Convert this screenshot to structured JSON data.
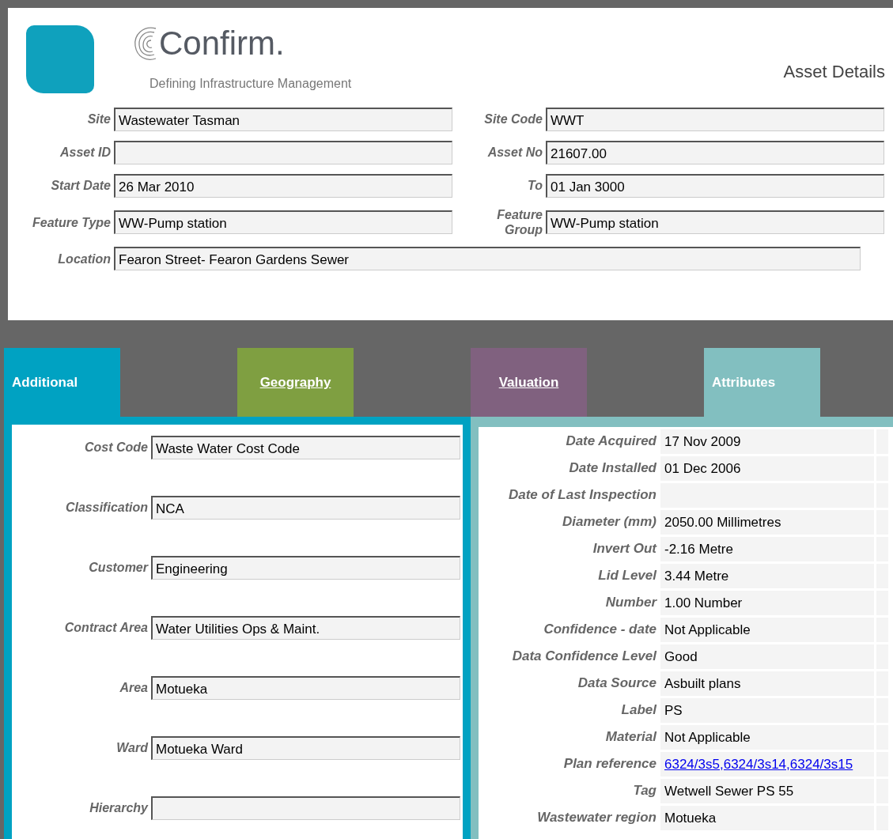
{
  "header": {
    "brand": "Confirm.",
    "tagline": "Defining Infrastructure Management",
    "page_title": "Asset Details"
  },
  "details": [
    {
      "label": "Site",
      "value": "Wastewater Tasman",
      "kind": "pair"
    },
    {
      "label": "Site Code",
      "value": "WWT",
      "kind": "pair"
    },
    {
      "label": "Asset ID",
      "kind": "pair"
    },
    {
      "label": "Asset No",
      "value": "21607.00",
      "kind": "pair"
    },
    {
      "label": "Start Date",
      "value": "26 Mar 2010",
      "kind": "pair"
    },
    {
      "label": "To",
      "value": "01 Jan 3000",
      "kind": "pair"
    },
    {
      "label": "Feature Type",
      "value": "WW-Pump station",
      "kind": "pair"
    },
    {
      "label": "Feature Group",
      "value": "WW-Pump station",
      "kind": "pair"
    },
    {
      "label": "Location",
      "value": "Fearon Street- Fearon Gardens Sewer",
      "kind": "wide"
    }
  ],
  "tabs": [
    {
      "label": "Additional",
      "selected": true,
      "color": "#00a2c2"
    },
    {
      "label": "Geography",
      "selected": false,
      "color": "#7f9f41"
    },
    {
      "label": "Valuation",
      "selected": false,
      "color": "#80617f"
    },
    {
      "label": "Attributes",
      "selected": true,
      "color": "#82bfc0"
    }
  ],
  "additional": [
    {
      "label": "Cost Code",
      "value": "Waste Water Cost Code"
    },
    {
      "label": "Classification",
      "value": "NCA"
    },
    {
      "label": "Customer",
      "value": "Engineering"
    },
    {
      "label": "Contract Area",
      "value": "Water Utilities Ops & Maint."
    },
    {
      "label": "Area",
      "value": "Motueka"
    },
    {
      "label": "Ward",
      "value": "Motueka Ward"
    },
    {
      "label": "Hierarchy"
    }
  ],
  "attributes": [
    {
      "label": "Date Acquired",
      "value": "17 Nov 2009",
      "kind": "text"
    },
    {
      "label": "Date Installed",
      "value": "01 Dec 2006",
      "kind": "text"
    },
    {
      "label": "Date of Last Inspection",
      "kind": "text"
    },
    {
      "label": "Diameter (mm)",
      "value": "2050.00 Millimetres",
      "kind": "text"
    },
    {
      "label": "Invert Out",
      "value": "-2.16 Metre",
      "kind": "text"
    },
    {
      "label": "Lid Level",
      "value": "3.44 Metre",
      "kind": "text"
    },
    {
      "label": "Number",
      "value": "1.00 Number",
      "kind": "text"
    },
    {
      "label": "Confidence - date",
      "value": "Not Applicable",
      "kind": "text"
    },
    {
      "label": "Data Confidence Level",
      "value": "Good",
      "kind": "text"
    },
    {
      "label": "Data Source",
      "value": "Asbuilt plans",
      "kind": "text"
    },
    {
      "label": "Label",
      "value": "PS",
      "kind": "text"
    },
    {
      "label": "Material",
      "value": "Not Applicable",
      "kind": "text"
    },
    {
      "label": "Plan reference",
      "value": "6324/3s5,6324/3s14,6324/3s15",
      "kind": "link"
    },
    {
      "label": "Tag",
      "value": "Wetwell Sewer PS 55",
      "kind": "text"
    },
    {
      "label": "Wastewater region",
      "value": "Motueka",
      "kind": "text"
    }
  ]
}
